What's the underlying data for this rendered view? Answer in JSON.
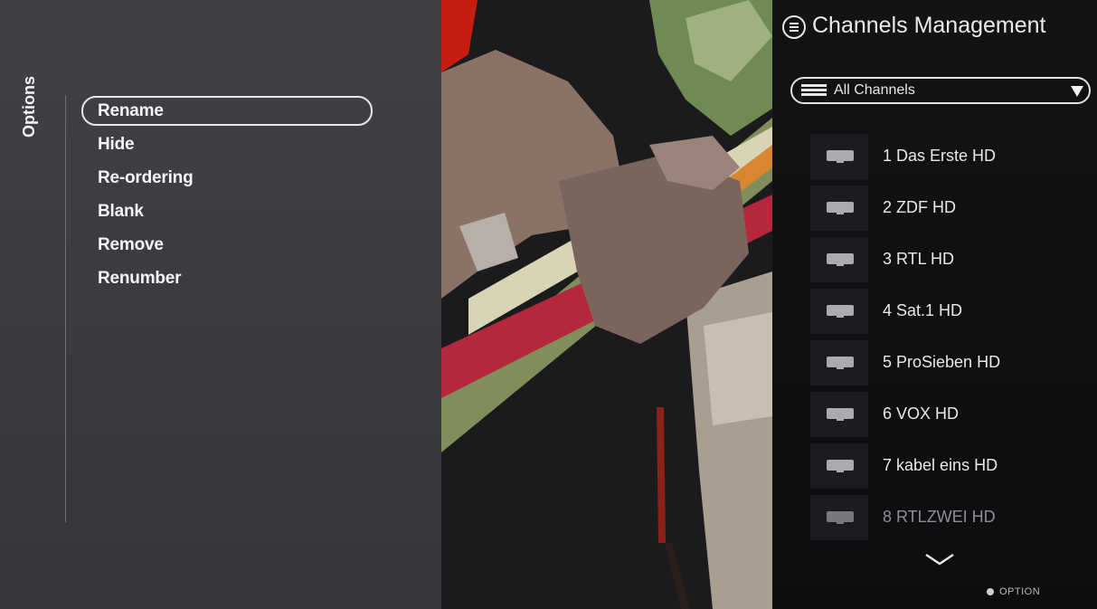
{
  "options_panel": {
    "vertical_label": "Options",
    "items": [
      {
        "label": "Rename",
        "focused": true
      },
      {
        "label": "Hide",
        "focused": false
      },
      {
        "label": "Re-ordering",
        "focused": false
      },
      {
        "label": "Blank",
        "focused": false
      },
      {
        "label": "Remove",
        "focused": false
      },
      {
        "label": "Renumber",
        "focused": false
      }
    ]
  },
  "channels_panel": {
    "title": "Channels Management",
    "title_icon": "menu-icon",
    "list_selector": {
      "label": "All Channels",
      "icon": "list-icon",
      "arrow_icon": "dropdown-arrow-icon"
    },
    "channels": [
      {
        "name": "1 Das Erste HD",
        "icon": "tv-icon"
      },
      {
        "name": "2 ZDF HD",
        "icon": "tv-icon"
      },
      {
        "name": "3 RTL HD",
        "icon": "tv-icon"
      },
      {
        "name": "4 Sat.1 HD",
        "icon": "tv-icon"
      },
      {
        "name": "5 ProSieben HD",
        "icon": "tv-icon"
      },
      {
        "name": "6 VOX HD",
        "icon": "tv-icon"
      },
      {
        "name": "7 kabel eins HD",
        "icon": "tv-icon"
      },
      {
        "name": "8 RTLZWEI HD",
        "icon": "tv-icon"
      }
    ],
    "scroll_icon": "chevron-down-icon",
    "option_hint": "OPTION"
  },
  "colors": {
    "options_panel_bg": "#3b3d40",
    "channels_panel_bg": "#101113",
    "text": "#ffffff"
  }
}
